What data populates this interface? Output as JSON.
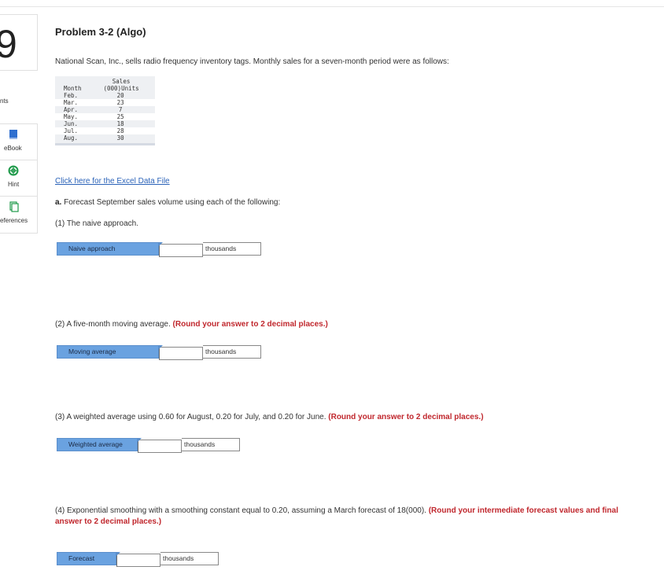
{
  "sidebar": {
    "question_number": "9",
    "partial_label_top": "nts",
    "items": [
      {
        "icon": "book-icon",
        "label": "eBook"
      },
      {
        "icon": "lifebuoy-icon",
        "label": "Hint"
      },
      {
        "icon": "copy-icon",
        "label": "eferences"
      }
    ]
  },
  "problem": {
    "title": "Problem 3-2 (Algo)",
    "intro": "National Scan, Inc., sells radio frequency inventory tags. Monthly sales for a seven-month period were as follows:",
    "table": {
      "header_sales": "Sales",
      "header_month": "Month",
      "header_units": "(000)Units",
      "rows": [
        {
          "month": "Feb.",
          "units": "20"
        },
        {
          "month": "Mar.",
          "units": "23"
        },
        {
          "month": "Apr.",
          "units": "7"
        },
        {
          "month": "May.",
          "units": "25"
        },
        {
          "month": "Jun.",
          "units": "18"
        },
        {
          "month": "Jul.",
          "units": "28"
        },
        {
          "month": "Aug.",
          "units": "30"
        }
      ]
    },
    "excel_link": "Click here for the Excel Data File",
    "part_a_prefix": "a.",
    "part_a_text": " Forecast September sales volume using each of the following:",
    "questions": [
      {
        "text": "(1) The naive approach.",
        "instruction": "",
        "answer_label": "Naive approach",
        "answer_value": "",
        "unit": "thousands"
      },
      {
        "text": "(2) A five-month moving average. ",
        "instruction": "(Round your answer to 2 decimal places.)",
        "answer_label": "Moving average",
        "answer_value": "",
        "unit": "thousands"
      },
      {
        "text": "(3) A weighted average using 0.60 for August, 0.20 for July, and 0.20 for June. ",
        "instruction": "(Round your answer to 2 decimal places.)",
        "answer_label": "Weighted average",
        "answer_value": "",
        "unit": "thousands"
      },
      {
        "text": "(4) Exponential smoothing with a smoothing constant equal to 0.20, assuming a March forecast of 18(000). ",
        "instruction": "(Round your intermediate forecast values and final answer to 2 decimal places.)",
        "answer_label": "Forecast",
        "answer_value": "",
        "unit": "thousands"
      }
    ]
  },
  "colors": {
    "answer_label_bg": "#6aa2e0",
    "link": "#2a62b8",
    "instruction_red": "#c0272d"
  }
}
